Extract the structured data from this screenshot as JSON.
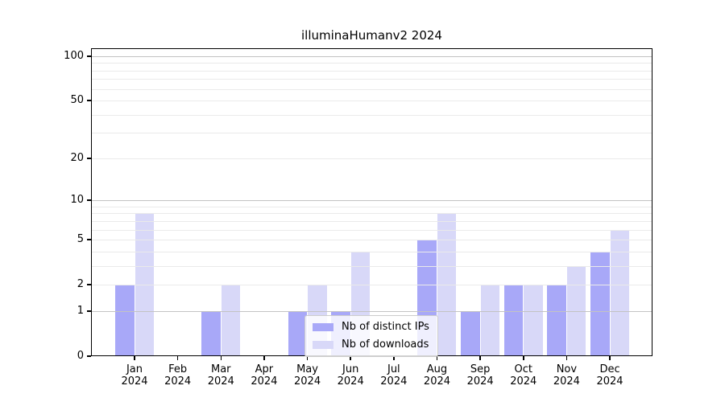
{
  "title": "illuminaHumanv2 2024",
  "chart_data": {
    "type": "bar",
    "title": "illuminaHumanv2 2024",
    "categories": [
      "Jan 2024",
      "Feb 2024",
      "Mar 2024",
      "Apr 2024",
      "May 2024",
      "Jun 2024",
      "Jul 2024",
      "Aug 2024",
      "Sep 2024",
      "Oct 2024",
      "Nov 2024",
      "Dec 2024"
    ],
    "series": [
      {
        "name": "Nb of distinct IPs",
        "color": "#a8a8f8",
        "values": [
          2,
          0,
          1,
          0,
          1,
          1,
          0,
          5,
          1,
          2,
          2,
          4
        ]
      },
      {
        "name": "Nb of downloads",
        "color": "#d8d8f8",
        "values": [
          8,
          0,
          2,
          0,
          2,
          4,
          0,
          8,
          2,
          2,
          3,
          6
        ]
      }
    ],
    "xlabel": "",
    "ylabel": "",
    "yscale": "log1p",
    "ylim": [
      0,
      113
    ],
    "y_tick_labels": [
      100,
      50,
      20,
      10,
      5,
      2,
      1,
      0
    ],
    "grid": {
      "major_values": [
        1,
        10,
        100
      ],
      "minor_values": [
        2,
        3,
        4,
        5,
        6,
        7,
        8,
        9,
        20,
        30,
        40,
        50,
        60,
        70,
        80,
        90
      ],
      "major_color": "#c3c3c3",
      "minor_color": "#eaeaea"
    },
    "legend_position": "lower center",
    "colors": {
      "axis": "#000000",
      "background": "#ffffff",
      "text": "#000000"
    }
  }
}
